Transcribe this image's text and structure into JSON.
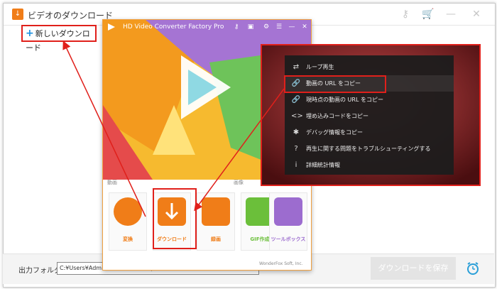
{
  "window": {
    "title": "ビデオのダウンロード",
    "new_download_label": "新しいダウンロード",
    "output_folder_label": "出力フォルダ：",
    "output_path": "C:¥Users¥Administrator¥Desktop",
    "download_all_label": "ダウンロードを保存"
  },
  "converter": {
    "title": "HD Video Converter Factory Pro",
    "section_left": "動画",
    "section_right": "画像",
    "tools": [
      {
        "label": "変換",
        "color": "#f07d18"
      },
      {
        "label": "ダウンロード",
        "color": "#f07d18"
      },
      {
        "label": "録画",
        "color": "#f07d18"
      },
      {
        "label": "GIF作成",
        "color": "#6bbf3a"
      },
      {
        "label": "ツールボックス",
        "color": "#9c6ccf"
      }
    ],
    "footer": "WonderFox Soft, Inc."
  },
  "context_menu": {
    "items": [
      {
        "icon": "loop-icon",
        "glyph": "⇄",
        "label": "ループ再生"
      },
      {
        "icon": "link-icon",
        "glyph": "🔗",
        "label": "動画の URL をコピー"
      },
      {
        "icon": "link-icon",
        "glyph": "🔗",
        "label": "現時点の動画の URL をコピー"
      },
      {
        "icon": "code-icon",
        "glyph": "<>",
        "label": "埋め込みコードをコピー"
      },
      {
        "icon": "bug-icon",
        "glyph": "✱",
        "label": "デバッグ情報をコピー"
      },
      {
        "icon": "help-icon",
        "glyph": "?",
        "label": "再生に関する問題をトラブルシューティングする"
      },
      {
        "icon": "info-icon",
        "glyph": "i",
        "label": "詳細統計情報"
      }
    ]
  },
  "colors": {
    "accent_red": "#e0201b",
    "orange": "#f07d18",
    "menu_bg": "#1c1c1c"
  }
}
